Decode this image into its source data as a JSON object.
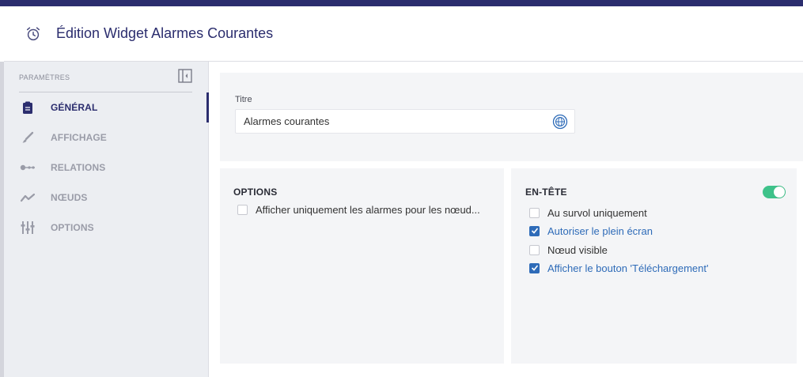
{
  "header": {
    "title": "Édition Widget Alarmes Courantes",
    "icon": "alarm-clock-icon"
  },
  "sidebar": {
    "section_label": "PARAMÈTRES",
    "items": [
      {
        "label": "GÉNÉRAL",
        "icon": "clipboard-icon",
        "active": true
      },
      {
        "label": "AFFICHAGE",
        "icon": "brush-icon",
        "active": false
      },
      {
        "label": "RELATIONS",
        "icon": "relations-icon",
        "active": false
      },
      {
        "label": "NŒUDS",
        "icon": "trend-line-icon",
        "active": false
      },
      {
        "label": "OPTIONS",
        "icon": "sliders-icon",
        "active": false
      }
    ]
  },
  "title_card": {
    "label": "Titre",
    "value": "Alarmes courantes"
  },
  "options_card": {
    "heading": "OPTIONS",
    "checkboxes": [
      {
        "label": "Afficher uniquement les alarmes pour les nœud...",
        "checked": false
      }
    ]
  },
  "header_card": {
    "heading": "EN-TÊTE",
    "toggle_on": true,
    "checkboxes": [
      {
        "label": "Au survol uniquement",
        "checked": false
      },
      {
        "label": "Autoriser le plein écran",
        "checked": true
      },
      {
        "label": "Nœud visible",
        "checked": false
      },
      {
        "label": "Afficher le bouton 'Téléchargement'",
        "checked": true
      }
    ]
  },
  "colors": {
    "primary": "#2b2d6e",
    "link_blue": "#2e6bb8",
    "toggle_green": "#3ec28a"
  }
}
